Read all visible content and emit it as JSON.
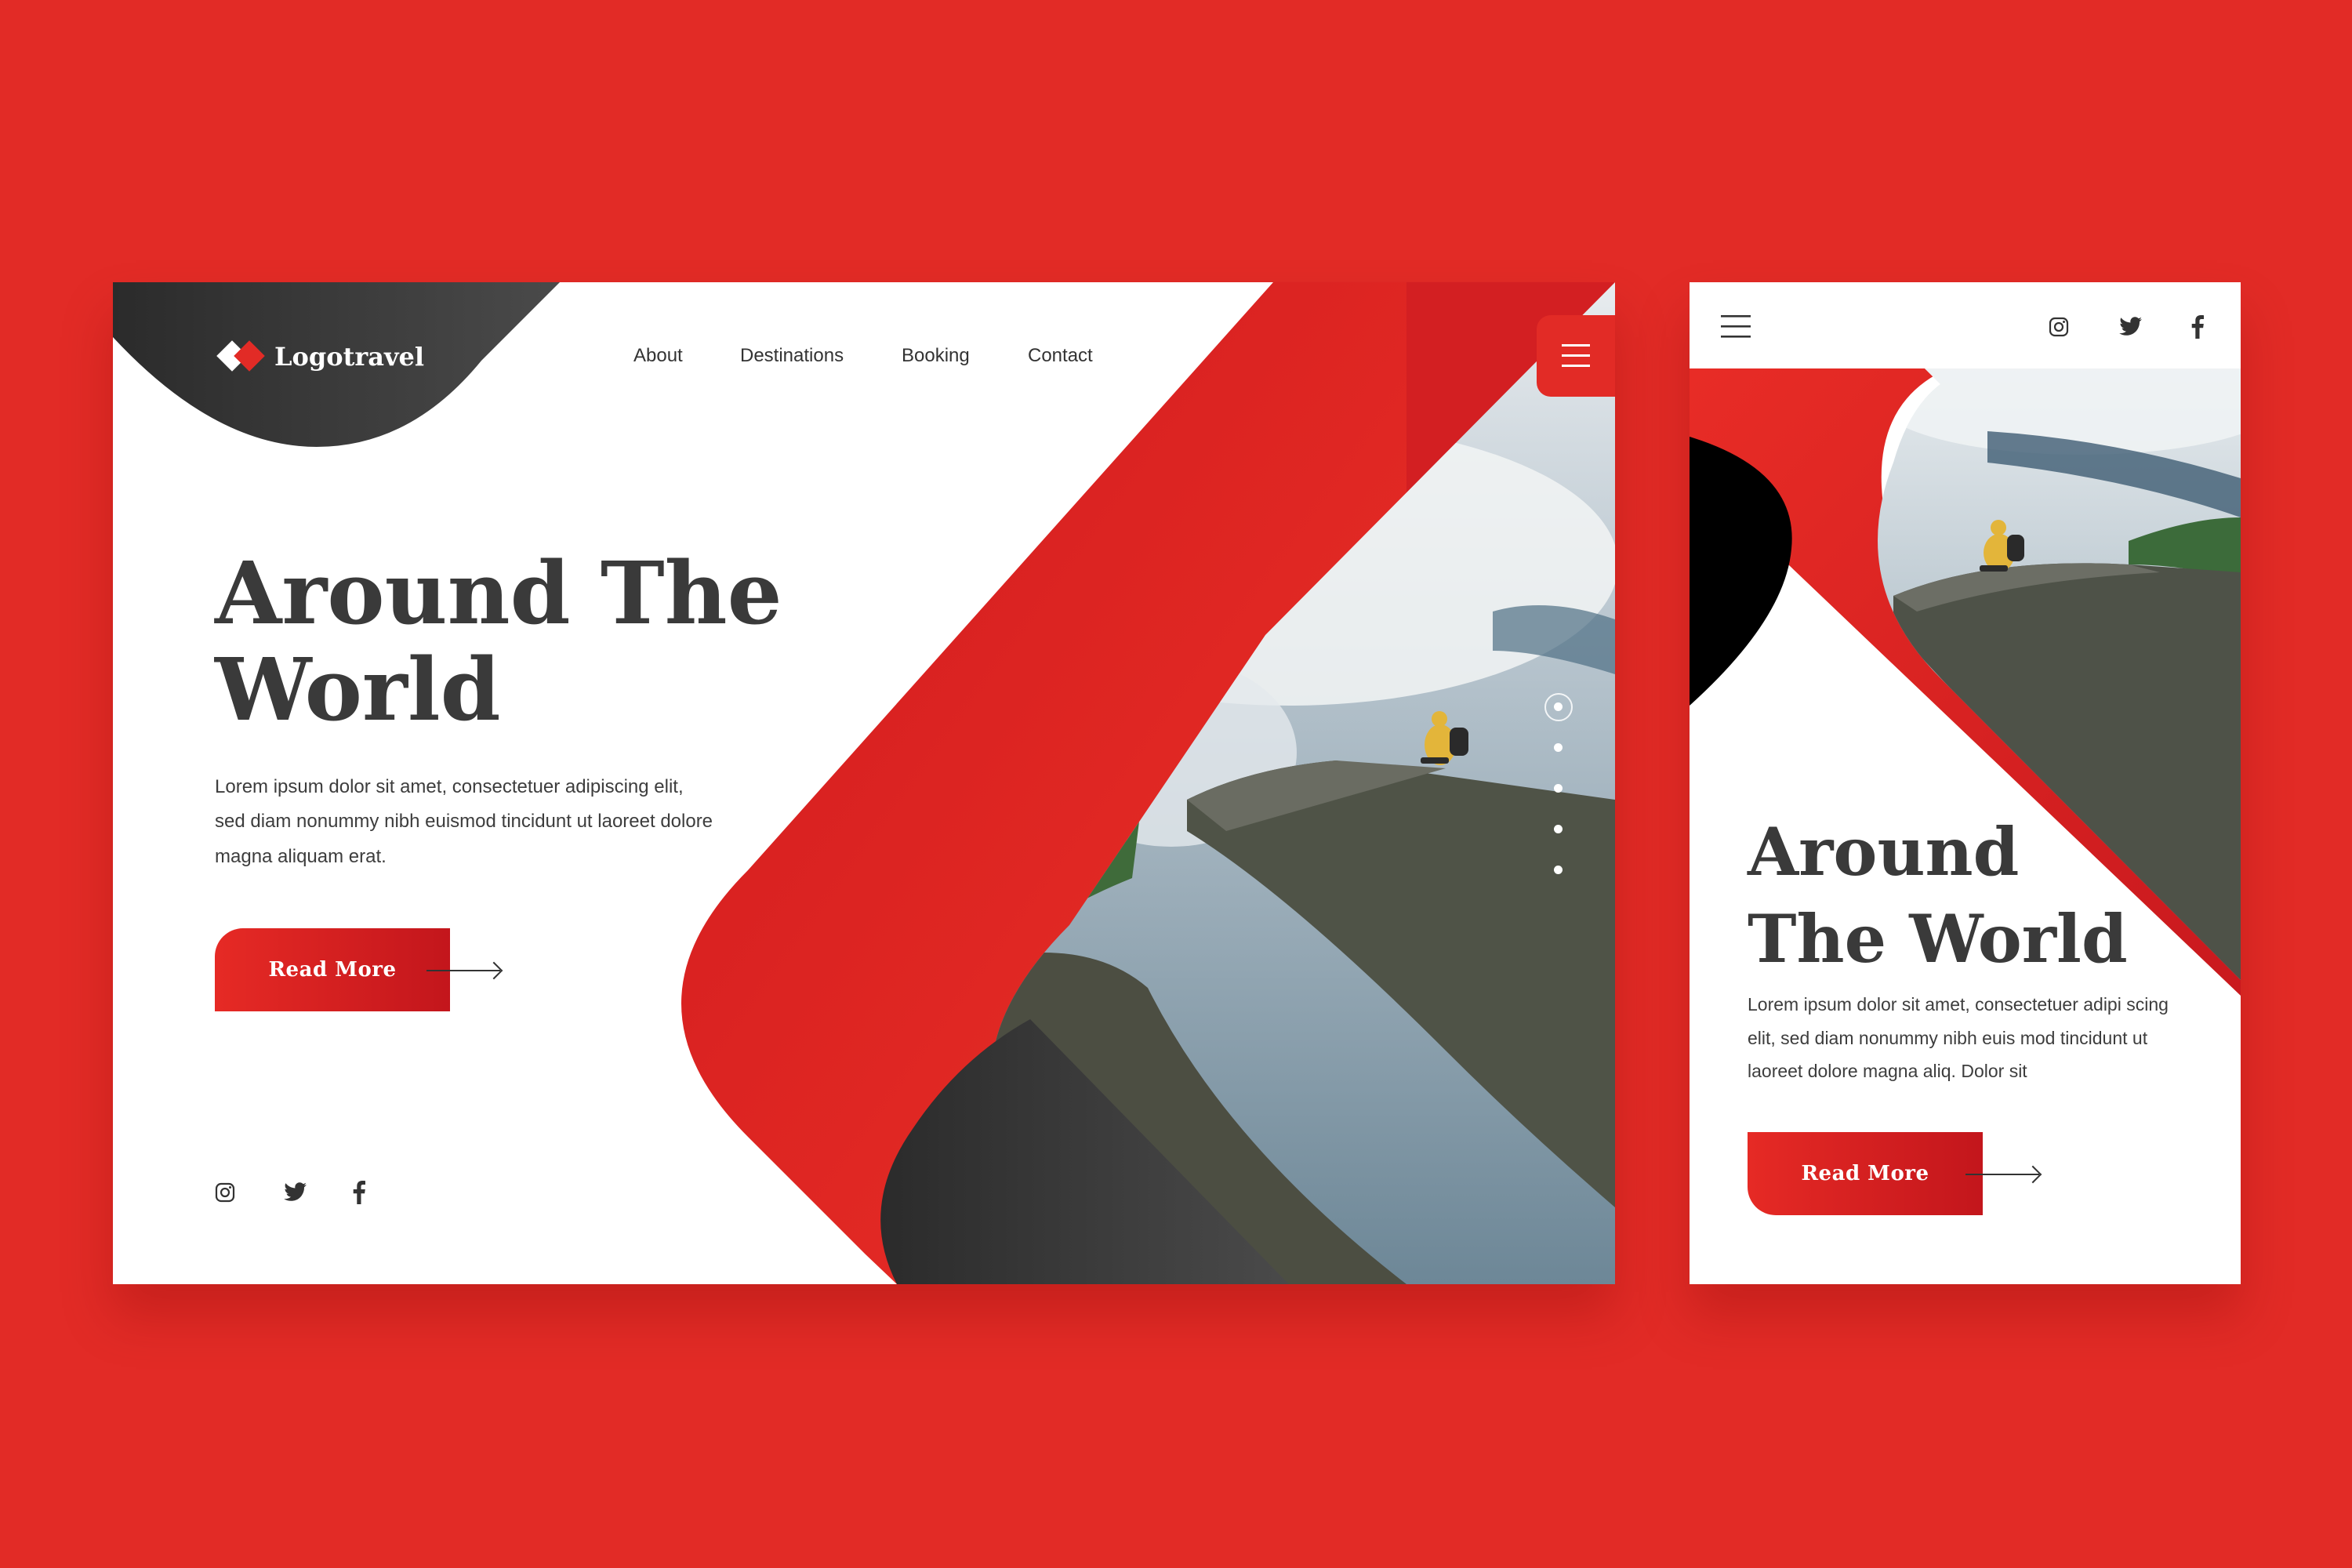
{
  "colors": {
    "background": "#e22b26",
    "accent": "#e22b26",
    "dark": "#3a3a3a"
  },
  "desktop": {
    "logo": {
      "text": "Logotravel",
      "icon": "diamond-logo-icon"
    },
    "nav": [
      "About",
      "Destinations",
      "Booking",
      "Contact"
    ],
    "menu_icon": "hamburger-icon",
    "headline": [
      "Around The",
      "World"
    ],
    "body": "Lorem ipsum dolor sit amet, consectetuer adipiscing elit, sed diam nonummy nibh euismod tincidunt ut laoreet dolore magna aliquam erat.",
    "cta": "Read More",
    "social": [
      "instagram-icon",
      "twitter-icon",
      "facebook-icon"
    ],
    "slider": {
      "count": 5,
      "active": 1
    }
  },
  "mobile": {
    "menu_icon": "hamburger-icon",
    "social": [
      "instagram-icon",
      "twitter-icon",
      "facebook-icon"
    ],
    "headline": [
      "Around",
      "The World"
    ],
    "body": "Lorem ipsum dolor sit amet, consectetuer adipi scing elit, sed diam nonummy nibh euis mod tincidunt ut laoreet dolore magna aliq. Dolor sit",
    "cta": "Read More"
  }
}
